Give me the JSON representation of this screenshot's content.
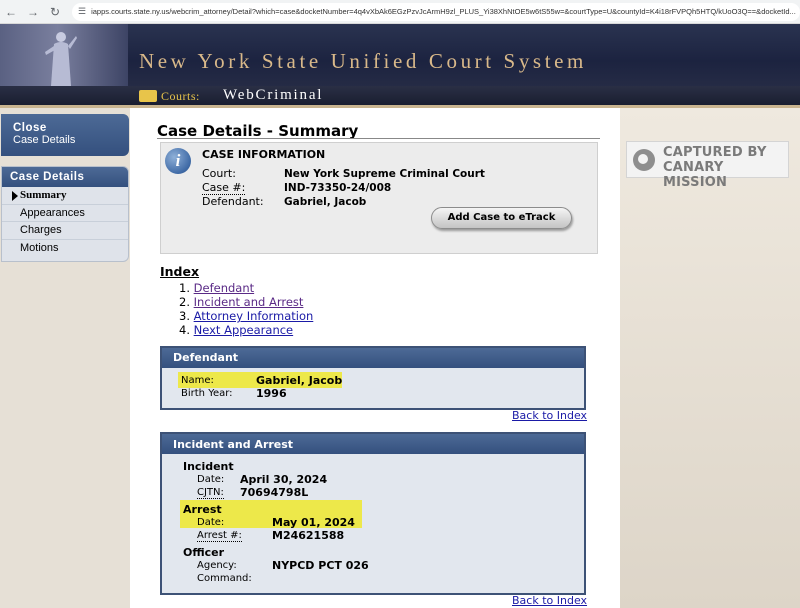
{
  "browser": {
    "url": "iapps.courts.state.ny.us/webcrim_attorney/Detail?which=case&docketNumber=4q4vXbAk6EGzPzvJcArmH9zl_PLUS_Yi38XhNtOE5w6tS55w=&courtType=U&countyId=K4i18rFVPQh5HTQ/kUoO3Q==&docketId..."
  },
  "header": {
    "title": "New York State Unified Court System",
    "courts_label": "Courts:",
    "app_name": "WebCriminal"
  },
  "sidebar": {
    "close": {
      "title": "Close",
      "subtitle": "Case Details"
    },
    "case_details_title": "Case Details",
    "items": [
      {
        "label": "Summary",
        "active": true
      },
      {
        "label": "Appearances"
      },
      {
        "label": "Charges"
      },
      {
        "label": "Motions"
      }
    ]
  },
  "page": {
    "title": "Case Details - Summary"
  },
  "case_info": {
    "heading": "CASE INFORMATION",
    "court_label": "Court:",
    "court_value": "New York Supreme Criminal Court",
    "case_label": "Case #:",
    "case_value": "IND-73350-24/008",
    "defendant_label": "Defendant:",
    "defendant_value": "Gabriel, Jacob",
    "etrack_button": "Add Case to eTrack"
  },
  "index": {
    "title": "Index",
    "items": [
      {
        "num": "1.",
        "label": "Defendant"
      },
      {
        "num": "2.",
        "label": "Incident and Arrest"
      },
      {
        "num": "3.",
        "label": "Attorney Information"
      },
      {
        "num": "4.",
        "label": "Next Appearance"
      }
    ]
  },
  "defendant_section": {
    "heading": "Defendant",
    "name_label": "Name:",
    "name_value": "Gabriel, Jacob",
    "birth_label": "Birth Year:",
    "birth_value": "1996",
    "back_link": "Back to Index"
  },
  "incident_section": {
    "heading": "Incident and Arrest",
    "incident_title": "Incident",
    "incident_date_label": "Date:",
    "incident_date_value": "April 30, 2024",
    "cjtn_label": "CJTN:",
    "cjtn_value": "70694798L",
    "arrest_title": "Arrest",
    "arrest_date_label": "Date:",
    "arrest_date_value": "May 01, 2024",
    "arrest_num_label": "Arrest #:",
    "arrest_num_value": "M24621588",
    "officer_title": "Officer",
    "agency_label": "Agency:",
    "agency_value": "NYPCD PCT 026",
    "command_label": "Command:",
    "back_link": "Back to Index"
  },
  "watermark": {
    "line1": "CAPTURED BY",
    "line2": "CANARY MISSION"
  },
  "colors": {
    "header_navy": "#1c2340",
    "header_gold": "#d9b98a",
    "section_blue": "#34507e",
    "highlight": "#ede84a"
  }
}
